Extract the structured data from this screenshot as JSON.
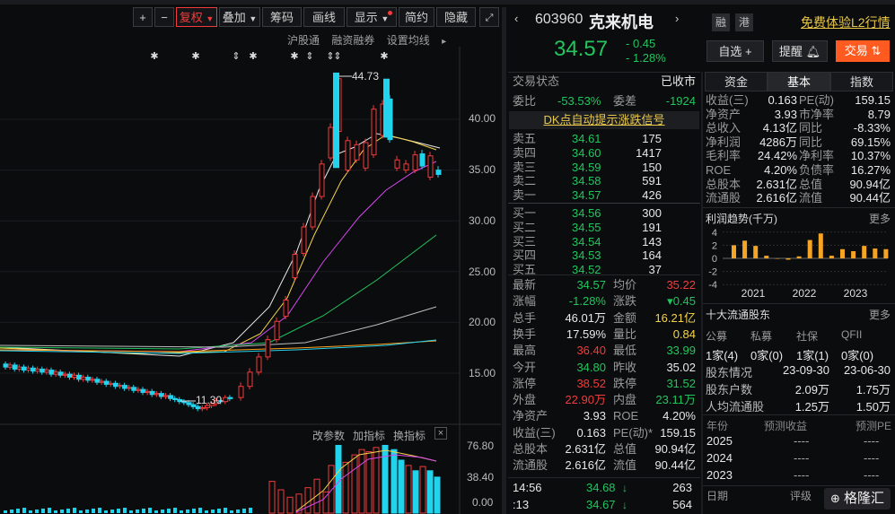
{
  "toolbar": {
    "plus": "+",
    "minus": "−",
    "fuquan": "复权",
    "diejia": "叠加",
    "chouma": "筹码",
    "huaxian": "画线",
    "xianshi": "显示",
    "jianyue": "简约",
    "yincang": "隐藏"
  },
  "subbar": {
    "hgt": "沪股通",
    "rzrq": "融资融券",
    "settings": "设置均线"
  },
  "chart": {
    "price_ticks": [
      "40.00",
      "35.00",
      "30.00",
      "25.00",
      "20.00",
      "15.00"
    ],
    "high_label": "44.73",
    "low_label": "11.30",
    "vol_menu": [
      "改参数",
      "加指标",
      "换指标"
    ],
    "vol_close": "×",
    "vol_ticks": [
      "76.80",
      "38.40",
      "0.00"
    ]
  },
  "stock": {
    "code": "603960",
    "name": "克来机电",
    "price": "34.57",
    "change": "- 0.45",
    "change_pct": "- 1.28%",
    "tag_rong": "融",
    "tag_gang": "港",
    "l2_link": "免费体验L2行情",
    "btn_zixuan": "自选 +",
    "btn_tixing": "提醒",
    "btn_jiaoyi": "交易"
  },
  "quote": {
    "status_label": "交易状态",
    "status_value": "已收市",
    "weibi_label": "委比",
    "weibi_value": "-53.53%",
    "weicha_label": "委差",
    "weicha_value": "-1924",
    "dk": "DK点自动提示涨跌信号",
    "asks": [
      {
        "label": "卖五",
        "price": "34.61",
        "vol": "175"
      },
      {
        "label": "卖四",
        "price": "34.60",
        "vol": "1417"
      },
      {
        "label": "卖三",
        "price": "34.59",
        "vol": "150"
      },
      {
        "label": "卖二",
        "price": "34.58",
        "vol": "591"
      },
      {
        "label": "卖一",
        "price": "34.57",
        "vol": "426"
      }
    ],
    "bids": [
      {
        "label": "买一",
        "price": "34.56",
        "vol": "300"
      },
      {
        "label": "买二",
        "price": "34.55",
        "vol": "191"
      },
      {
        "label": "买三",
        "price": "34.54",
        "vol": "143"
      },
      {
        "label": "买四",
        "price": "34.53",
        "vol": "164"
      },
      {
        "label": "买五",
        "price": "34.52",
        "vol": "37"
      }
    ],
    "stats": [
      {
        "l1": "最新",
        "v1": "34.57",
        "c1": "green",
        "l2": "均价",
        "v2": "35.22",
        "c2": "red"
      },
      {
        "l1": "涨幅",
        "v1": "-1.28%",
        "c1": "green",
        "l2": "涨跌",
        "v2": "▾0.45",
        "c2": "green"
      },
      {
        "l1": "总手",
        "v1": "46.01万",
        "c1": "white",
        "l2": "金额",
        "v2": "16.21亿",
        "c2": "yellow"
      },
      {
        "l1": "换手",
        "v1": "17.59%",
        "c1": "white",
        "l2": "量比",
        "v2": "0.84",
        "c2": "yellow"
      },
      {
        "l1": "最高",
        "v1": "36.40",
        "c1": "red",
        "l2": "最低",
        "v2": "33.99",
        "c2": "green"
      },
      {
        "l1": "今开",
        "v1": "34.80",
        "c1": "green",
        "l2": "昨收",
        "v2": "35.02",
        "c2": "white"
      },
      {
        "l1": "涨停",
        "v1": "38.52",
        "c1": "red",
        "l2": "跌停",
        "v2": "31.52",
        "c2": "green"
      },
      {
        "l1": "外盘",
        "v1": "22.90万",
        "c1": "red",
        "l2": "内盘",
        "v2": "23.11万",
        "c2": "green"
      },
      {
        "l1": "净资产",
        "v1": "3.93",
        "c1": "white",
        "l2": "ROE",
        "v2": "4.20%",
        "c2": "white"
      },
      {
        "l1": "收益(三)",
        "v1": "0.163",
        "c1": "white",
        "l2": "PE(动)*",
        "v2": "159.15",
        "c2": "white"
      },
      {
        "l1": "总股本",
        "v1": "2.631亿",
        "c1": "white",
        "l2": "总值",
        "v2": "90.94亿",
        "c2": "white"
      },
      {
        "l1": "流通股",
        "v1": "2.616亿",
        "c1": "white",
        "l2": "流值",
        "v2": "90.44亿",
        "c2": "white"
      }
    ],
    "ticks": [
      {
        "time": "14:56",
        "price": "34.68",
        "vol": "263"
      },
      {
        "time": ":13",
        "price": "34.67",
        "vol": "564"
      }
    ]
  },
  "fund": {
    "tabs": [
      "资金",
      "基本",
      "指数"
    ],
    "rows": [
      {
        "l1": "收益(三)",
        "v1": "0.163",
        "l2": "PE(动)",
        "v2": "159.15"
      },
      {
        "l1": "净资产",
        "v1": "3.93",
        "l2": "市净率",
        "v2": "8.79"
      },
      {
        "l1": "总收入",
        "v1": "4.13亿",
        "l2": "同比",
        "v2": "-8.33%"
      },
      {
        "l1": "净利润",
        "v1": "4286万",
        "l2": "同比",
        "v2": "69.15%"
      },
      {
        "l1": "毛利率",
        "v1": "24.42%",
        "l2": "净利率",
        "v2": "10.37%"
      },
      {
        "l1": "ROE",
        "v1": "4.20%",
        "l2": "负债率",
        "v2": "16.27%"
      },
      {
        "l1": "总股本",
        "v1": "2.631亿",
        "l2": "总值",
        "v2": "90.94亿"
      },
      {
        "l1": "流通股",
        "v1": "2.616亿",
        "l2": "流值",
        "v2": "90.44亿"
      }
    ],
    "profit_title": "利润趋势(千万)",
    "more": "更多",
    "profit_chart": {
      "type": "bar",
      "y_ticks": [
        "4",
        "2",
        "0",
        "-2",
        "-4"
      ],
      "ylim": [
        -4,
        5
      ],
      "x_labels": [
        "2021",
        "2022",
        "2023"
      ],
      "values": [
        2.0,
        2.7,
        1.9,
        0.4,
        0,
        -0.2,
        0.3,
        2.8,
        3.8,
        0.4,
        1.4,
        1.1,
        1.9,
        1.5,
        1.4
      ]
    },
    "holders_title": "十大流通股东",
    "holders_headers": [
      "公募",
      "私募",
      "社保",
      "QFII"
    ],
    "holders_values": [
      "1家(4)",
      "0家(0)",
      "1家(1)",
      "0家(0)"
    ],
    "share_rows": [
      {
        "l": "股东情况",
        "a": "23-09-30",
        "b": "23-06-30"
      },
      {
        "l": "股东户数",
        "a": "2.09万",
        "b": "1.75万"
      },
      {
        "l": "人均流通股",
        "a": "1.25万",
        "b": "1.50万"
      }
    ],
    "forecast_headers": [
      "年份",
      "预测收益",
      "预测PE"
    ],
    "forecast_rows": [
      {
        "year": "2025",
        "eps": "----",
        "pe": "----"
      },
      {
        "year": "2024",
        "eps": "----",
        "pe": "----"
      },
      {
        "year": "2023",
        "eps": "----",
        "pe": "----"
      }
    ],
    "rating_headers": [
      "日期",
      "评级"
    ],
    "watermark": "格隆汇"
  }
}
